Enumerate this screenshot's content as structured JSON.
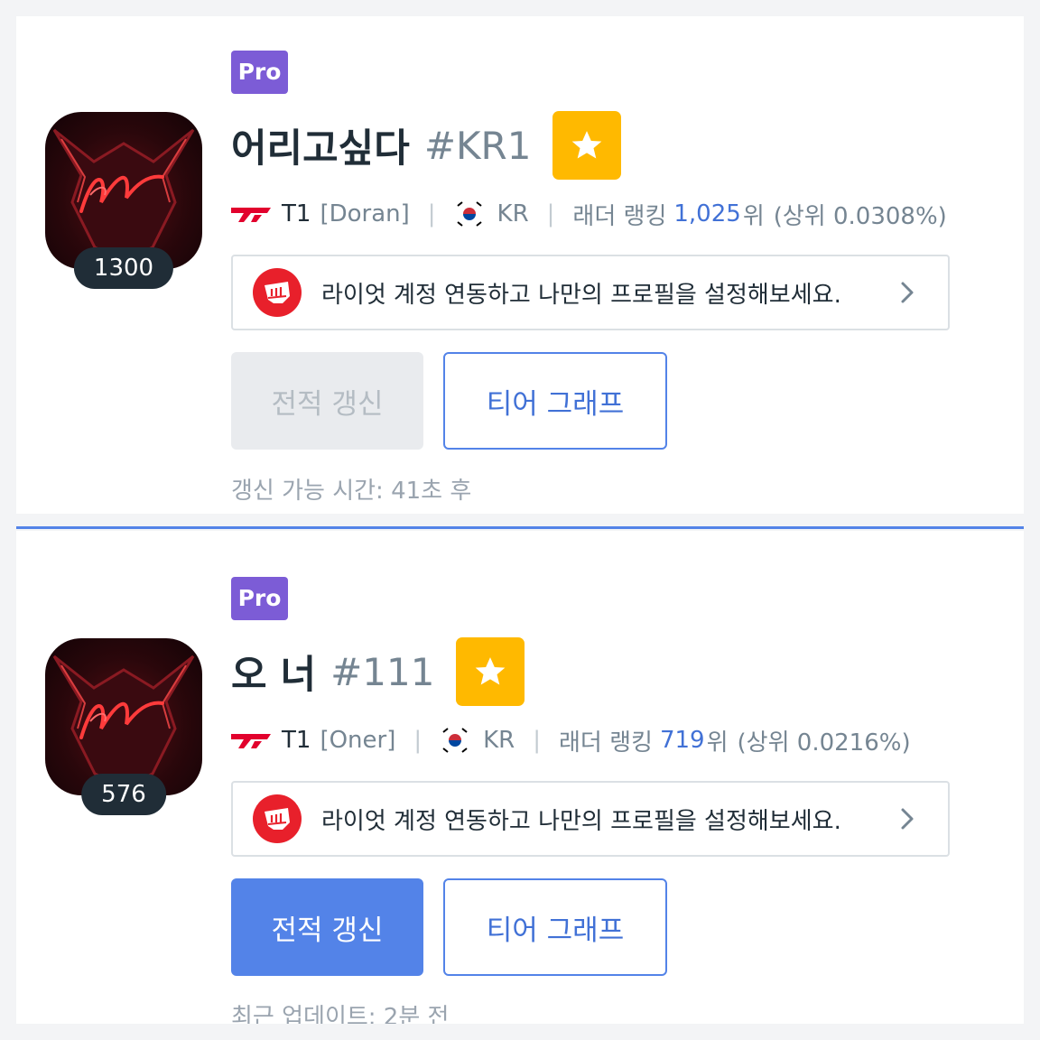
{
  "profiles": [
    {
      "badge": "Pro",
      "level": "1300",
      "name": "어리고싶다",
      "tag": "#KR1",
      "team": "T1",
      "player": "[Doran]",
      "separator": "|",
      "region": "KR",
      "ladder_label": "래더 랭킹",
      "rank": "1,025",
      "rank_suffix": "위",
      "top_percent": "(상위 0.0308%)",
      "riot_prompt": "라이엇 계정 연동하고 나만의 프로필을 설정해보세요.",
      "update_button": "전적 갱신",
      "update_enabled": false,
      "tier_button": "티어 그래프",
      "note": "갱신 가능 시간: 41초 후"
    },
    {
      "badge": "Pro",
      "level": "576",
      "name": "오 너",
      "tag": "#111",
      "team": "T1",
      "player": "[Oner]",
      "separator": "|",
      "region": "KR",
      "ladder_label": "래더 랭킹",
      "rank": "719",
      "rank_suffix": "위",
      "top_percent": "(상위 0.0216%)",
      "riot_prompt": "라이엇 계정 연동하고 나만의 프로필을 설정해보세요.",
      "update_button": "전적 갱신",
      "update_enabled": true,
      "tier_button": "티어 그래프",
      "note": "최근 업데이트: 2분 전"
    }
  ],
  "colors": {
    "accent": "#5383e8",
    "pro_badge": "#7c5cd6",
    "star": "#ffb900",
    "riot_red": "#e8202b",
    "rank_blue": "#4171d6"
  },
  "icons": {
    "favorite": "star-icon",
    "riot": "riot-fist-icon",
    "expand": "chevron-right-icon",
    "team": "t1-logo-icon",
    "region": "korea-flag-icon"
  }
}
